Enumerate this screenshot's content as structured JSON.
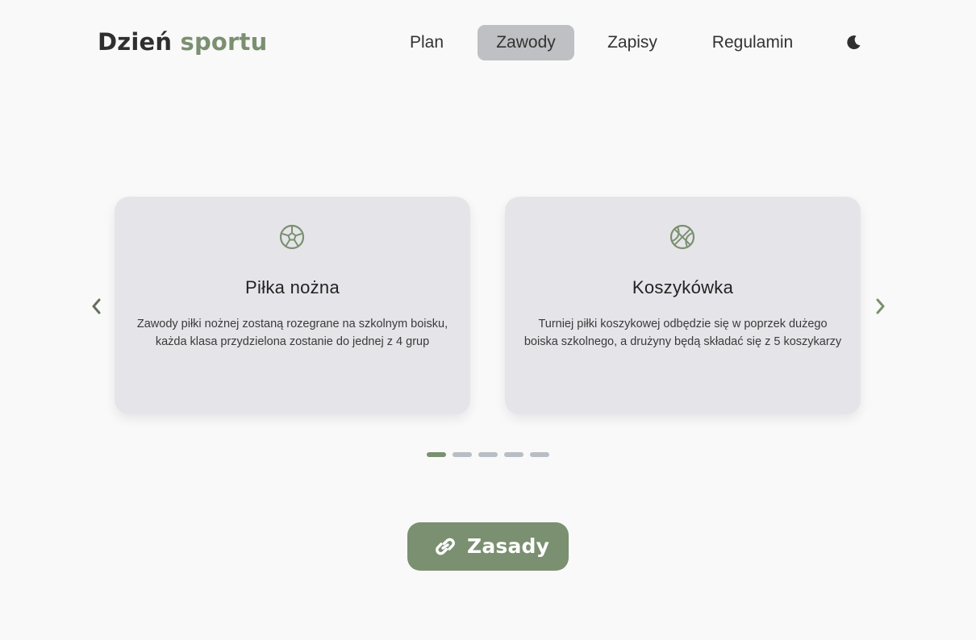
{
  "header": {
    "logo_part1": "Dzień",
    "logo_part2": "sportu",
    "nav": [
      {
        "label": "Plan",
        "active": false
      },
      {
        "label": "Zawody",
        "active": true
      },
      {
        "label": "Zapisy",
        "active": false
      },
      {
        "label": "Regulamin",
        "active": false
      }
    ],
    "theme_icon": "moon-icon"
  },
  "carousel": {
    "cards": [
      {
        "icon": "soccer-ball-icon",
        "title": "Piłka nożna",
        "description": "Zawody piłki nożnej zostaną rozegrane na szkolnym boisku, każda klasa przydzielona zostanie do jednej z 4 grup"
      },
      {
        "icon": "basketball-icon",
        "title": "Koszykówka",
        "description": "Turniej piłki koszykowej odbędzie się w poprzek dużego boiska szkolnego, a drużyny będą składać się z 5 koszykarzy"
      }
    ],
    "dots_count": 5,
    "active_dot": 0,
    "prev_icon": "chevron-left-icon",
    "next_icon": "chevron-right-icon"
  },
  "cta": {
    "label": "Zasady",
    "icon": "link-icon"
  },
  "colors": {
    "accent": "#7a9070",
    "background": "#f9f9f9",
    "card": "#e5e5e9",
    "nav_active": "#bfc0c3",
    "dot_inactive": "#b8bec4"
  }
}
